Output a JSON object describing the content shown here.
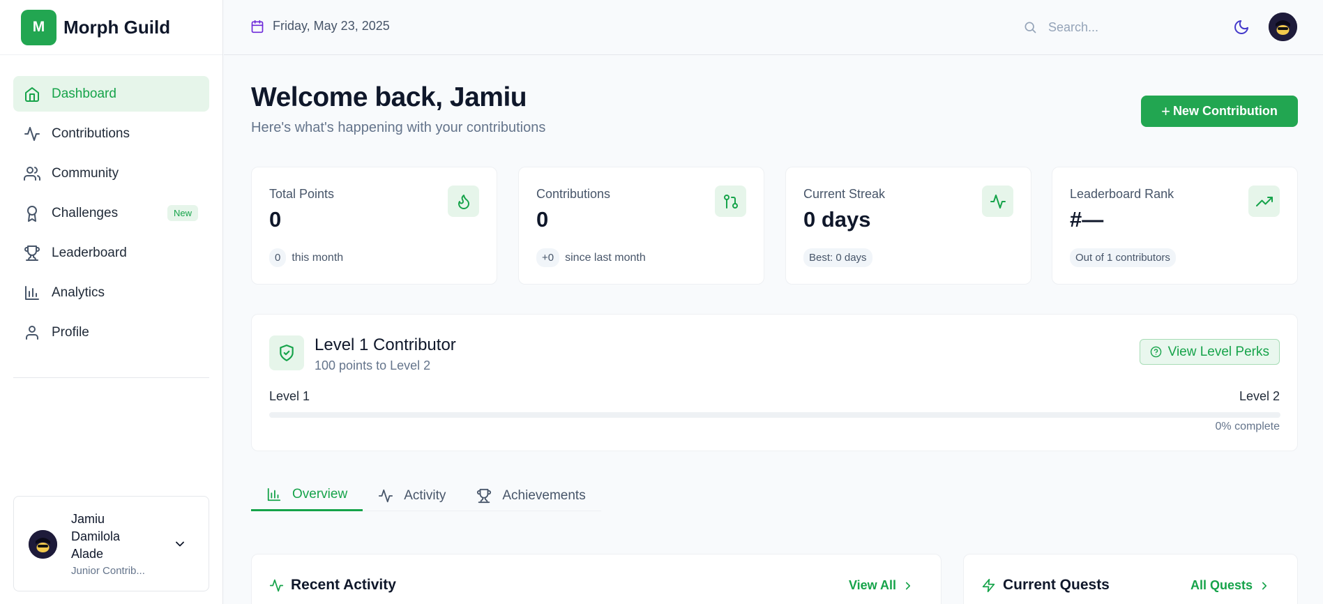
{
  "brand": {
    "logo_letter": "M",
    "name": "Morph Guild"
  },
  "header": {
    "date": "Friday, May 23, 2025",
    "search_placeholder": "Search..."
  },
  "sidebar": {
    "items": [
      {
        "label": "Dashboard",
        "icon": "home-icon",
        "active": true
      },
      {
        "label": "Contributions",
        "icon": "activity-icon"
      },
      {
        "label": "Community",
        "icon": "users-icon"
      },
      {
        "label": "Challenges",
        "icon": "award-icon",
        "badge": "New"
      },
      {
        "label": "Leaderboard",
        "icon": "trophy-icon"
      },
      {
        "label": "Analytics",
        "icon": "bar-chart-icon"
      },
      {
        "label": "Profile",
        "icon": "user-icon"
      }
    ],
    "user": {
      "name": "Jamiu Damilola Alade",
      "role": "Junior Contrib..."
    }
  },
  "main": {
    "welcome": "Welcome back, Jamiu",
    "subtitle": "Here's what's happening with your contributions",
    "new_button": "New Contribution",
    "stats": [
      {
        "label": "Total Points",
        "value": "0",
        "pill": "0",
        "foot": "this month",
        "icon": "flame-icon"
      },
      {
        "label": "Contributions",
        "value": "0",
        "pill": "+0",
        "foot": "since last month",
        "icon": "git-pull-request-icon"
      },
      {
        "label": "Current Streak",
        "value": "0 days",
        "pill": "Best: 0 days",
        "foot": "",
        "icon": "activity-icon"
      },
      {
        "label": "Leaderboard Rank",
        "value": "#—",
        "pill": "Out of 1 contributors",
        "foot": "",
        "icon": "trending-up-icon"
      }
    ],
    "level": {
      "title": "Level 1 Contributor",
      "subtitle": "100 points to Level 2",
      "perks_button": "View Level Perks",
      "from": "Level 1",
      "to": "Level 2",
      "progress_percent": 0,
      "progress_text": "0% complete"
    },
    "tabs": [
      {
        "label": "Overview",
        "active": true
      },
      {
        "label": "Activity"
      },
      {
        "label": "Achievements"
      }
    ],
    "panels": {
      "recent_activity": {
        "title": "Recent Activity",
        "link": "View All"
      },
      "current_quests": {
        "title": "Current Quests",
        "link": "All Quests"
      }
    }
  },
  "colors": {
    "accent": "#22a651",
    "accent_soft": "#e6f5ea",
    "text": "#0f172a",
    "muted": "#64748b"
  }
}
